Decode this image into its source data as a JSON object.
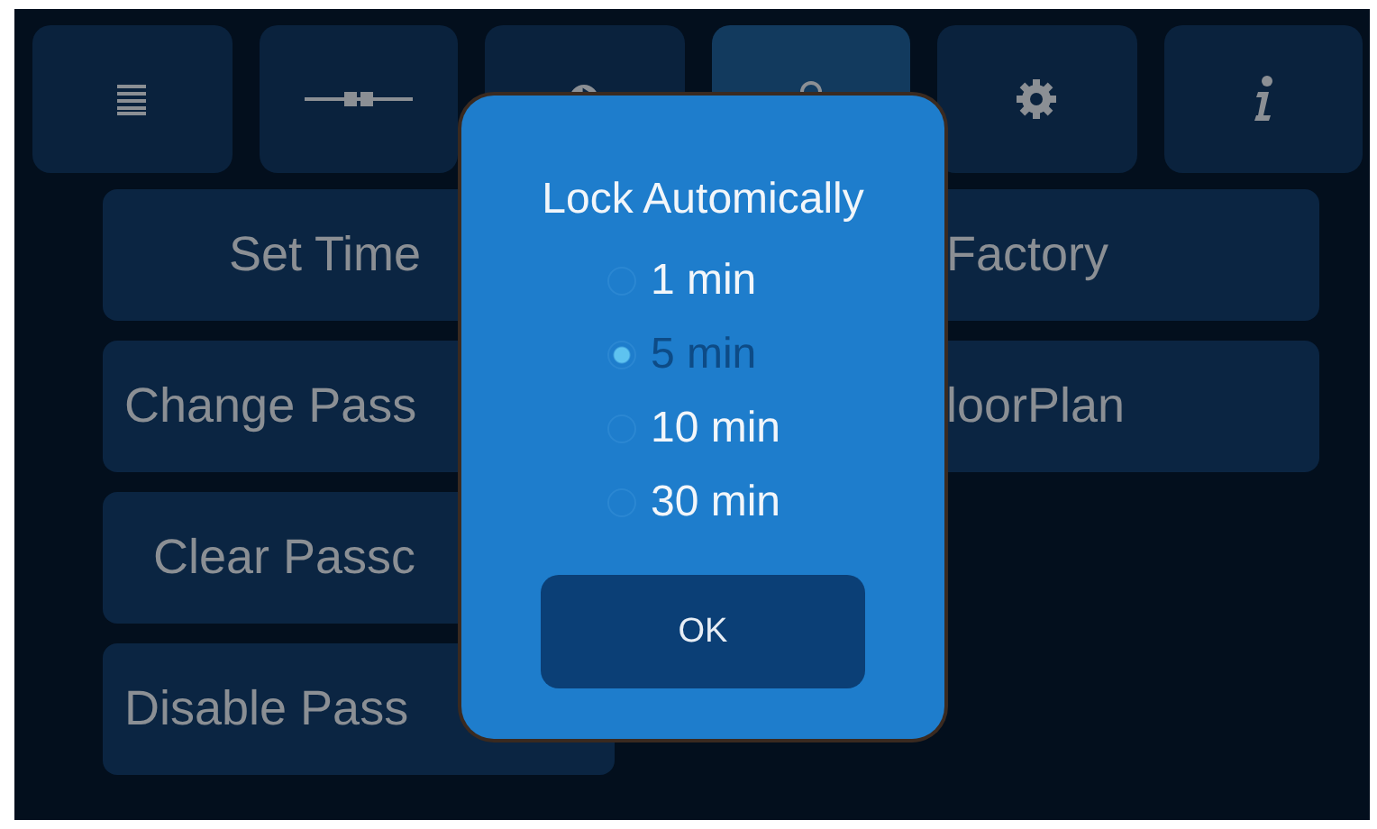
{
  "tabs": [
    {
      "selected": false
    },
    {
      "selected": false
    },
    {
      "selected": false
    },
    {
      "selected": true
    },
    {
      "selected": false
    },
    {
      "selected": false
    }
  ],
  "buttons_left": [
    "Set Time",
    "Change Pass",
    "Clear Passc",
    "Disable Pass"
  ],
  "buttons_right": [
    "Factory",
    "loorPlan"
  ],
  "dialog": {
    "title": "Lock Automically",
    "options": [
      {
        "label": "1 min",
        "selected": false
      },
      {
        "label": "5 min",
        "selected": true
      },
      {
        "label": "10 min",
        "selected": false
      },
      {
        "label": "30 min",
        "selected": false
      }
    ],
    "ok": "OK"
  }
}
